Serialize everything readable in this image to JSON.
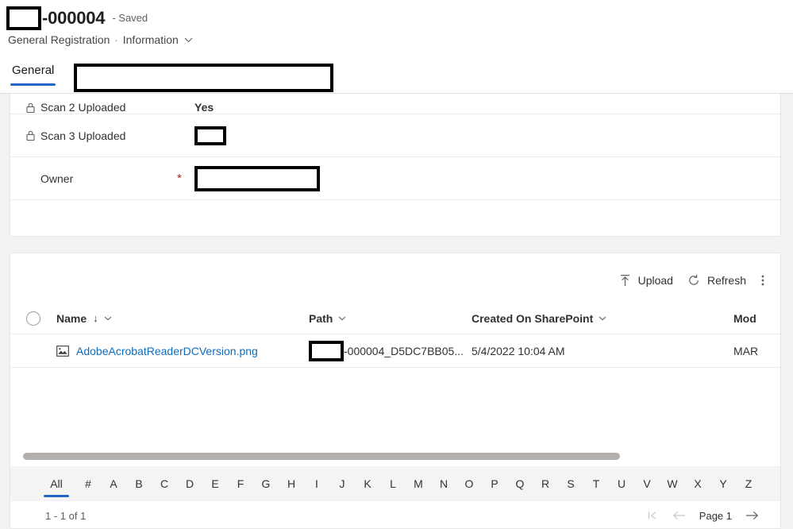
{
  "header": {
    "record_id": "-000004",
    "save_state": "- Saved",
    "entity": "General Registration",
    "separator": "·",
    "form_name": "Information",
    "redacted_prefix": ""
  },
  "tabs": [
    {
      "label": "General",
      "active": true
    }
  ],
  "form": {
    "fields": [
      {
        "label": "Scan 2 Uploaded",
        "value": "Yes",
        "locked": true,
        "required": false,
        "redacted": false
      },
      {
        "label": "Scan 3 Uploaded",
        "value": "",
        "locked": true,
        "required": false,
        "redacted": true
      },
      {
        "label": "Owner",
        "value": "",
        "locked": false,
        "required": true,
        "redacted": true
      }
    ]
  },
  "grid": {
    "toolbar": {
      "upload_label": "Upload",
      "refresh_label": "Refresh",
      "more_label": "More commands"
    },
    "columns": [
      {
        "key": "name",
        "label": "Name",
        "sorted": "asc"
      },
      {
        "key": "path",
        "label": "Path",
        "sorted": "none"
      },
      {
        "key": "created",
        "label": "Created On SharePoint",
        "sorted": "none"
      },
      {
        "key": "modified",
        "label": "Mod",
        "sorted": "none"
      }
    ],
    "rows": [
      {
        "name": "AdobeAcrobatReaderDCVersion.png",
        "path": "-000004_D5DC7BB05...",
        "created": "5/4/2022 10:04 AM",
        "modified": "MAR"
      }
    ],
    "alpha_filter": {
      "items": [
        "All",
        "#",
        "A",
        "B",
        "C",
        "D",
        "E",
        "F",
        "G",
        "H",
        "I",
        "J",
        "K",
        "L",
        "M",
        "N",
        "O",
        "P",
        "Q",
        "R",
        "S",
        "T",
        "U",
        "V",
        "W",
        "X",
        "Y",
        "Z"
      ],
      "selected": "All"
    },
    "footer": {
      "record_count": "1 - 1 of 1",
      "page_label": "Page 1"
    }
  },
  "colors": {
    "accent": "#2266cc",
    "link": "#0f6cbd",
    "required": "#a4262c",
    "panel_bg": "#ffffff",
    "app_bg": "#f3f2f1",
    "alpha_bar_bg": "#f5f4f3",
    "scroll_thumb": "#b3b0ad"
  }
}
